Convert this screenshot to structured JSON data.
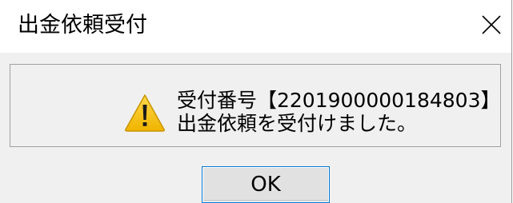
{
  "dialog": {
    "title": "出金依頼受付",
    "close_icon": "close-icon",
    "message": {
      "icon": "warning-icon",
      "line1": "受付番号【2201900000184803】",
      "line2": "出金依頼を受付けました。"
    },
    "ok_label": "OK"
  },
  "colors": {
    "content_background": "#f0f0f0",
    "titlebar_background": "#ffffff",
    "warning_fill": "#f5c518",
    "button_focus_border": "#0078d7"
  }
}
